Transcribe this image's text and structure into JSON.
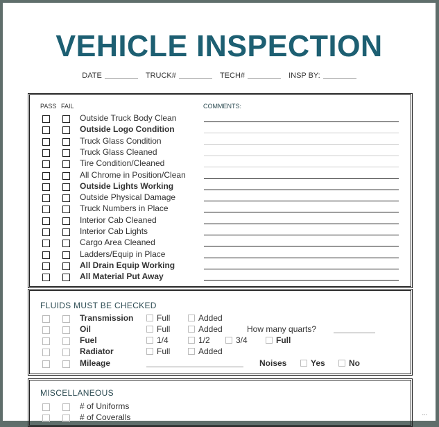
{
  "title": "VEHICLE INSPECTION",
  "meta_fields": [
    {
      "label": "DATE"
    },
    {
      "label": "TRUCK#"
    },
    {
      "label": "TECH#"
    },
    {
      "label": "INSP BY:"
    }
  ],
  "checklist": {
    "pass_header": "PASS",
    "fail_header": "FAIL",
    "comments_header": "COMMENTS:",
    "items": [
      {
        "label": "Outside Truck Body Clean",
        "bold": false
      },
      {
        "label": "Outside Logo Condition",
        "bold": true
      },
      {
        "label": "Truck Glass Condition",
        "bold": false
      },
      {
        "label": "Truck Glass Cleaned",
        "bold": false
      },
      {
        "label": "Tire Condition/Cleaned",
        "bold": false
      },
      {
        "label": "All Chrome in Position/Clean",
        "bold": false
      },
      {
        "label": "Outside Lights Working",
        "bold": true
      },
      {
        "label": "Outside Physical Damage",
        "bold": false
      },
      {
        "label": "Truck Numbers in Place",
        "bold": false
      },
      {
        "label": "Interior Cab Cleaned",
        "bold": false
      },
      {
        "label": "Interior Cab Lights",
        "bold": false
      },
      {
        "label": "Cargo Area Cleaned",
        "bold": false
      },
      {
        "label": "Ladders/Equip in Place",
        "bold": false
      },
      {
        "label": "All Drain Equip Working",
        "bold": true
      },
      {
        "label": "All Material Put Away",
        "bold": true
      }
    ]
  },
  "fluids": {
    "title": "FLUIDS MUST BE CHECKED",
    "rows": [
      {
        "name": "Transmission",
        "options": [
          "Full",
          "Added"
        ]
      },
      {
        "name": "Oil",
        "options": [
          "Full",
          "Added"
        ],
        "extra": "How many quarts?"
      },
      {
        "name": "Fuel",
        "options": [
          "1/4",
          "1/2",
          "3/4",
          "Full"
        ]
      },
      {
        "name": "Radiator",
        "options": [
          "Full",
          "Added"
        ]
      },
      {
        "name": "Mileage",
        "noises_label": "Noises",
        "noises_options": [
          "Yes",
          "No"
        ]
      }
    ]
  },
  "misc": {
    "title": "MISCELLANEOUS",
    "items": [
      {
        "label": "# of Uniforms"
      },
      {
        "label": "# of Coveralls"
      }
    ]
  },
  "ellipsis": "..."
}
